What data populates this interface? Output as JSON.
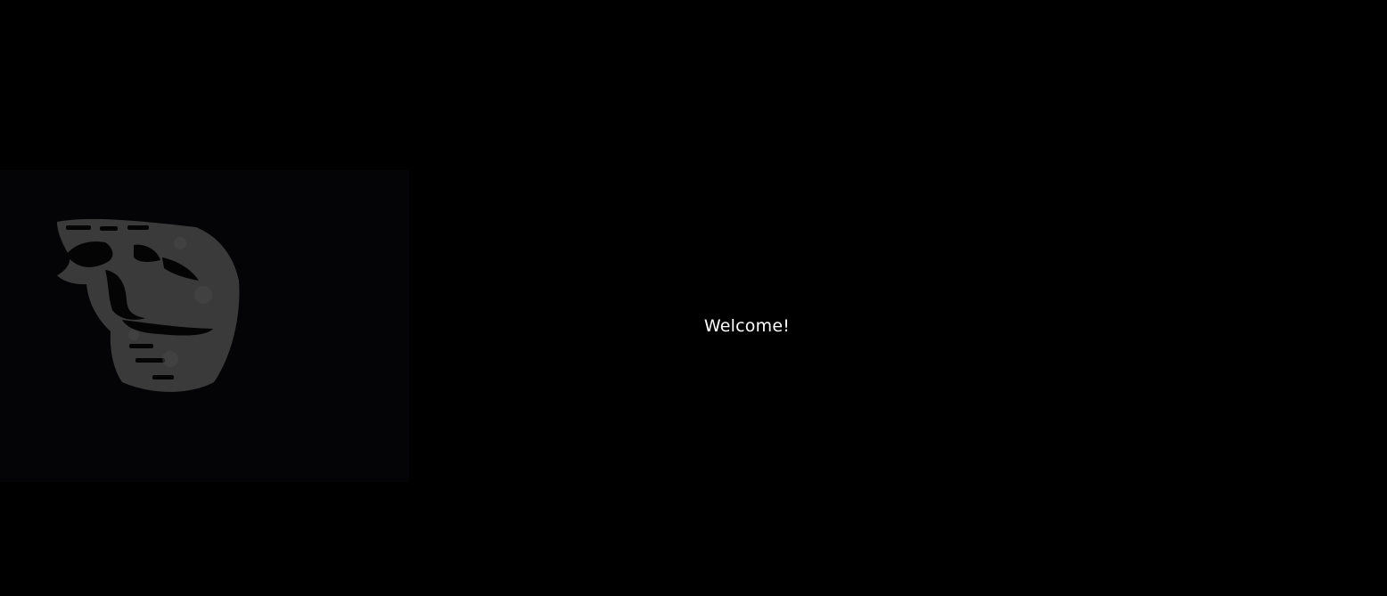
{
  "screen": {
    "background_color": "#000000",
    "message": "Welcome!",
    "message_color": "#ffffff"
  },
  "image": {
    "subject": "face-image",
    "panel_color": "#040305",
    "face_color": "#3a3a3a"
  }
}
